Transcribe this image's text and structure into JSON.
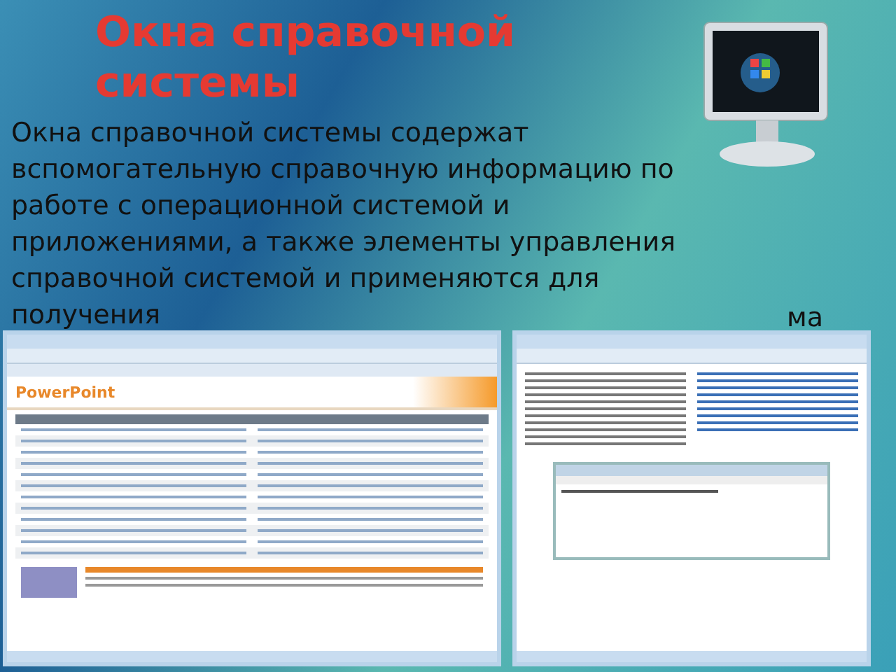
{
  "slide": {
    "title": "Окна справочной системы",
    "paragraph": "Окна справочной системы содержат вспомогательную справочную информацию по работе с операционной системой и приложениями, а также элементы управления справочной системой и применяются для получения",
    "covered_fragment": "ма"
  },
  "screenshots": [
    {
      "kind": "office-help",
      "header": "PowerPoint"
    },
    {
      "kind": "windows-help"
    }
  ]
}
